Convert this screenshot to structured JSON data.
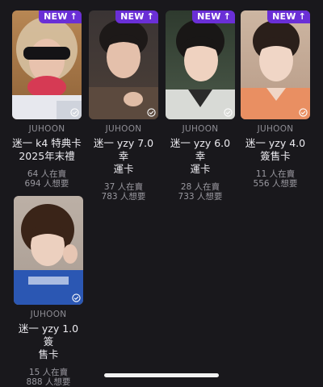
{
  "badges": {
    "new_label": "NEW",
    "arrow": "↑"
  },
  "cards": [
    {
      "artist": "JUHOON",
      "title_line1": "迷一 k4 特典卡",
      "title_line2": "2025年末禮",
      "selling": "64 人在賣",
      "wanting": "694 人想要",
      "is_new": true,
      "check_icon": "check-circle-icon"
    },
    {
      "artist": "JUHOON",
      "title_line1": "迷一 yzy 7.0 幸",
      "title_line2": "運卡",
      "selling": "37 人在賣",
      "wanting": "783 人想要",
      "is_new": true,
      "check_icon": "check-circle-icon"
    },
    {
      "artist": "JUHOON",
      "title_line1": "迷一 yzy 6.0 幸",
      "title_line2": "運卡",
      "selling": "28 人在賣",
      "wanting": "733 人想要",
      "is_new": true,
      "check_icon": "check-circle-icon"
    },
    {
      "artist": "JUHOON",
      "title_line1": "迷一 yzy 4.0",
      "title_line2": "簽售卡",
      "selling": "11 人在賣",
      "wanting": "556 人想要",
      "is_new": true,
      "check_icon": "check-circle-icon"
    },
    {
      "artist": "JUHOON",
      "title_line1": "迷一 yzy 1.0 簽",
      "title_line2": "售卡",
      "selling": "15 人在賣",
      "wanting": "888 人想要",
      "is_new": false,
      "check_icon": "check-circle-icon"
    }
  ],
  "colors": {
    "background": "#19181c",
    "new_badge": "#6a2fd6",
    "muted_text": "#8e8d94",
    "home_indicator": "#f2f2f2"
  }
}
